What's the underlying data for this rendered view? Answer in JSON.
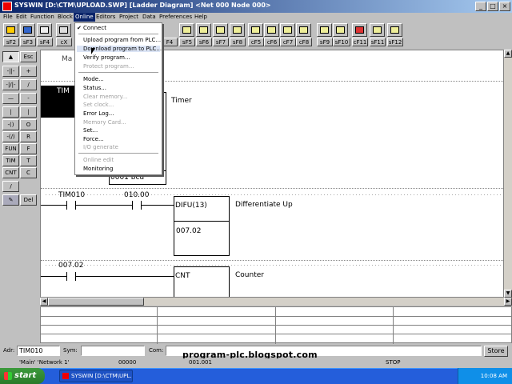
{
  "window": {
    "title": "SYSWIN [D:\\CTM\\UPLOAD.SWP] [Ladder Diagram] <Net 000 Node 000>",
    "min": "_",
    "max": "□",
    "close": "×"
  },
  "menubar": [
    "File",
    "Edit",
    "Function",
    "Block",
    "Online",
    "Editors",
    "Project",
    "Data",
    "Preferences",
    "Help"
  ],
  "toolbar_keys": [
    "sF2",
    "sF3",
    "sF4",
    "cX",
    "F4",
    "sF5",
    "sF6",
    "sF7",
    "sF8",
    "cF5",
    "cF6",
    "cF7",
    "cF8",
    "sF9",
    "sF10",
    "cF11",
    "sF11",
    "sF12"
  ],
  "online_menu": {
    "connect": "Connect",
    "upload": "Upload program from PLC...",
    "download": "Download program to PLC...",
    "verify": "Verify program...",
    "protect": "Protect program...",
    "mode": "Mode...",
    "status": "Status...",
    "clear_memory": "Clear memory...",
    "set_clock": "Set clock...",
    "error_log": "Error Log...",
    "memory_card": "Memory Card...",
    "set": "Set...",
    "force": "Force...",
    "io_generate": "I/O generate",
    "online_edit": "Online edit",
    "monitoring": "Monitoring"
  },
  "palette": [
    "Esc",
    "+",
    "/",
    "-",
    "|",
    "O",
    "R",
    "F",
    "T",
    "C",
    "Del",
    "FUN",
    "TIM",
    "CNT"
  ],
  "ladder": {
    "top_label": "Ma",
    "tim_label": "TIM",
    "timer_desc": "Timer",
    "timer_value": "0001 bcd",
    "rung2": {
      "contact1": "TIM010",
      "contact2": "010.00",
      "instr": "DIFU(13)",
      "operand": "007.02",
      "desc": "Differentiate Up"
    },
    "rung3": {
      "contact1": "007.02",
      "instr": "CNT",
      "desc": "Counter"
    }
  },
  "statusbar": {
    "adr_label": "Adr:",
    "adr_value": "TIM010",
    "sym_label": "Sym:",
    "com_label": "Com:",
    "store_button": "Store"
  },
  "infobar": {
    "tabs": "'Main'  'Network 1'",
    "addr1": "00000",
    "addr2": "001.001",
    "mode": "STOP"
  },
  "watermark": "program-plc.blogspot.com",
  "taskbar": {
    "start": "start",
    "item": "SYSWIN [D:\\CTM\\UPL...",
    "clock": "10:08 AM"
  }
}
